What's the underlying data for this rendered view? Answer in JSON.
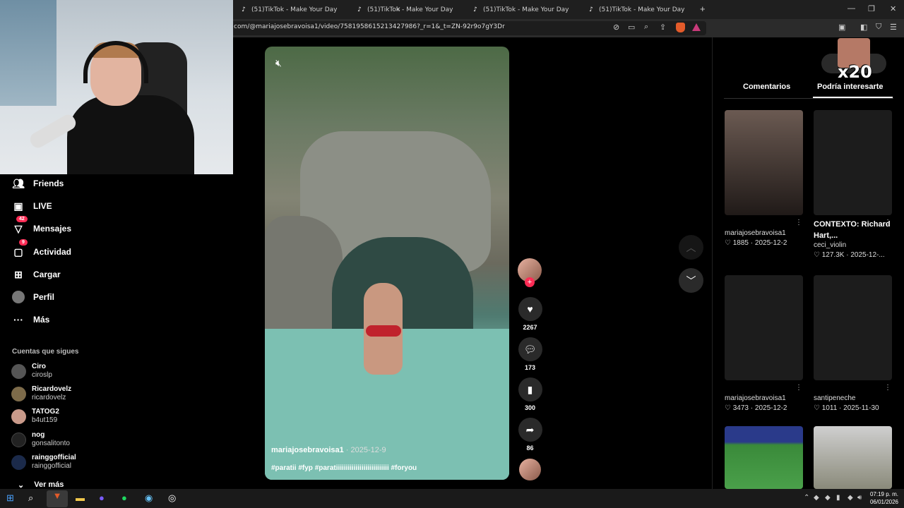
{
  "browser": {
    "tabs": [
      {
        "title": "(51)TikTok - Make Your Day"
      },
      {
        "title": "(51)TikTok - Make Your Day"
      },
      {
        "title": "(51)TikTok - Make Your Day"
      },
      {
        "title": "(51)TikTok - Make Your Day"
      }
    ],
    "url": "com/@mariajosebravoisa1/video/7581958615213427986?_r=1&_t=ZN-92r9o7gY3Dr"
  },
  "sidebar": {
    "items": [
      {
        "label": "Friends",
        "icon": "friends-icon"
      },
      {
        "label": "LIVE",
        "icon": "live-icon"
      },
      {
        "label": "Mensajes",
        "icon": "messages-icon",
        "badge": "42"
      },
      {
        "label": "Actividad",
        "icon": "activity-icon",
        "badge": "9"
      },
      {
        "label": "Cargar",
        "icon": "upload-icon"
      },
      {
        "label": "Perfil",
        "icon": "profile-avatar"
      },
      {
        "label": "Más",
        "icon": "more-icon"
      }
    ],
    "following_title": "Cuentas que sigues",
    "following": [
      {
        "name": "Ciro",
        "handle": "ciroslp"
      },
      {
        "name": "Ricardovelz",
        "handle": "ricardovelz"
      },
      {
        "name": "TATOG2",
        "handle": "b4ut159"
      },
      {
        "name": "nog",
        "handle": "gonsalitonto"
      },
      {
        "name": "rainggofficial",
        "handle": "rainggofficial"
      }
    ],
    "see_more": "Ver más"
  },
  "video": {
    "author": "mariajosebravoisa1",
    "date": " · 2025-12-9",
    "caption": "#paratii #fyp #paratiiiiiiiiiiiiiiiiiiiiiiiiiii #foryou"
  },
  "actions": {
    "likes": "2267",
    "comments": "173",
    "saves": "300",
    "shares": "86"
  },
  "right_panel": {
    "tab_comments": "Comentarios",
    "tab_interest": "Podría interesarte",
    "overlay_text": "x20",
    "cards": [
      {
        "title": "",
        "author": "mariajosebravoisa1",
        "likes": "1885",
        "date": "2025-12-2"
      },
      {
        "title": "CONTEXTO: Richard Hart,...",
        "author": "ceci_violin",
        "likes": "127.3K",
        "date": "2025-12-..."
      },
      {
        "title": "",
        "author": "mariajosebravoisa1",
        "likes": "3473",
        "date": "2025-12-2"
      },
      {
        "title": "",
        "author": "santipeneche",
        "likes": "1011",
        "date": "2025-11-30"
      }
    ]
  },
  "taskbar": {
    "time": "07:19 p. m.",
    "date": "06/01/2026"
  }
}
